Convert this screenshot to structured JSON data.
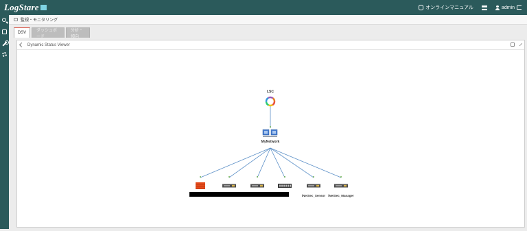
{
  "app": {
    "logo_text": "LogStare"
  },
  "header": {
    "manual_label": "オンラインマニュアル",
    "user_label": "admin"
  },
  "breadcrumb": {
    "text": "監視・モニタリング"
  },
  "tabs": [
    {
      "label": "DSV",
      "active": true
    },
    {
      "label": "ダッシュボード",
      "active": false
    },
    {
      "label": "分析・傾向",
      "active": false
    }
  ],
  "panel": {
    "title": "Dynamic Status Viewer"
  },
  "topology": {
    "root": {
      "label": "LSC",
      "icon": "color-wheel-icon"
    },
    "network": {
      "label": "MyNetwork",
      "icon": "network-switch-icon"
    },
    "devices": [
      {
        "label": "",
        "type": "firewall",
        "color": "#e44a1b"
      },
      {
        "label": "",
        "type": "appliance"
      },
      {
        "label": "",
        "type": "appliance"
      },
      {
        "label": "",
        "type": "switch"
      },
      {
        "label": "iNetSec_Sensor",
        "type": "appliance"
      },
      {
        "label": "iNetSec_Manager",
        "type": "appliance"
      }
    ],
    "link_color": "#5b8fc7",
    "status_color": "#6ab04c"
  }
}
